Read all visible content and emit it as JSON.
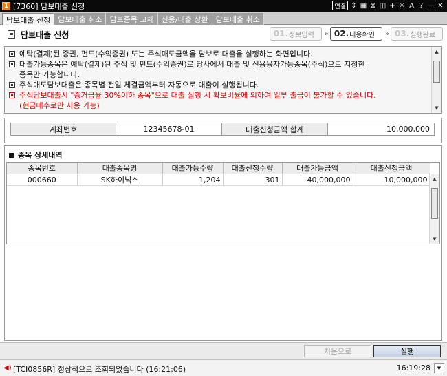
{
  "window": {
    "icon_label": "1",
    "title": "[7360] 담보대출 신청",
    "tools": [
      "연결",
      "⇕",
      "▦",
      "⊠",
      "◫",
      "+",
      "☼",
      "A",
      "?",
      "—",
      "✕"
    ]
  },
  "tabs": [
    {
      "label": "담보대출 신청",
      "active": true
    },
    {
      "label": "담보대출 취소",
      "active": false
    },
    {
      "label": "담보종목 교체",
      "active": false
    },
    {
      "label": "신용/대출 상환",
      "active": false
    },
    {
      "label": "담보대출 취소",
      "active": false
    }
  ],
  "header": {
    "title": "담보대출 신청",
    "steps": [
      {
        "num": "01.",
        "label": "정보입력",
        "active": false
      },
      {
        "num": "02.",
        "label": "내용확인",
        "active": true
      },
      {
        "num": "03.",
        "label": "실행완료",
        "active": false
      }
    ],
    "step_arrow": "»"
  },
  "notice": {
    "lines": [
      {
        "text": "예탁(결제)된 증권, 펀드(수익증권) 또는 주식매도금액을 담보로 대출을 실행하는 화면입니다.",
        "bullet": true,
        "red": false
      },
      {
        "text": "대출가능종목은 예탁(결제)된 주식 및 펀드(수익증권)로 당사에서 대출 및 신용융자가능종목(주식)으로 지정한",
        "bullet": true,
        "red": false
      },
      {
        "text": "종목만 가능합니다.",
        "bullet": false,
        "red": false
      },
      {
        "text": "주식매도담보대출은 종목별 전일 체결금액부터 자동으로 대출이 실행됩니다.",
        "bullet": true,
        "red": false
      },
      {
        "text": "주식담보대출시 \"증거금율 30%이하 종목\"으로 대출 실행 시 확보비율에 의하여 일부 출금이 불가할 수 있습니다.",
        "bullet": true,
        "red": true
      },
      {
        "text": "(현금매수로만 사용 가능)",
        "bullet": false,
        "red": true
      }
    ]
  },
  "account": {
    "account_label": "계좌번호",
    "account_value": "12345678-01",
    "total_label": "대출신청금액 합계",
    "total_value": "10,000,000"
  },
  "detail": {
    "section_title": "종목 상세내역",
    "columns": [
      "종목번호",
      "대출종목명",
      "대출가능수량",
      "대출신청수량",
      "대출가능금액",
      "대출신청금액"
    ],
    "rows": [
      [
        "000660",
        "SK하이닉스",
        "1,204",
        "301",
        "40,000,000",
        "10,000,000"
      ]
    ]
  },
  "actions": {
    "first_label": "처음으로",
    "execute_label": "실행"
  },
  "status": {
    "message": "[TCI0856R] 정상적으로 조회되었습니다 (16:21:06)",
    "clock": "16:19:28"
  }
}
